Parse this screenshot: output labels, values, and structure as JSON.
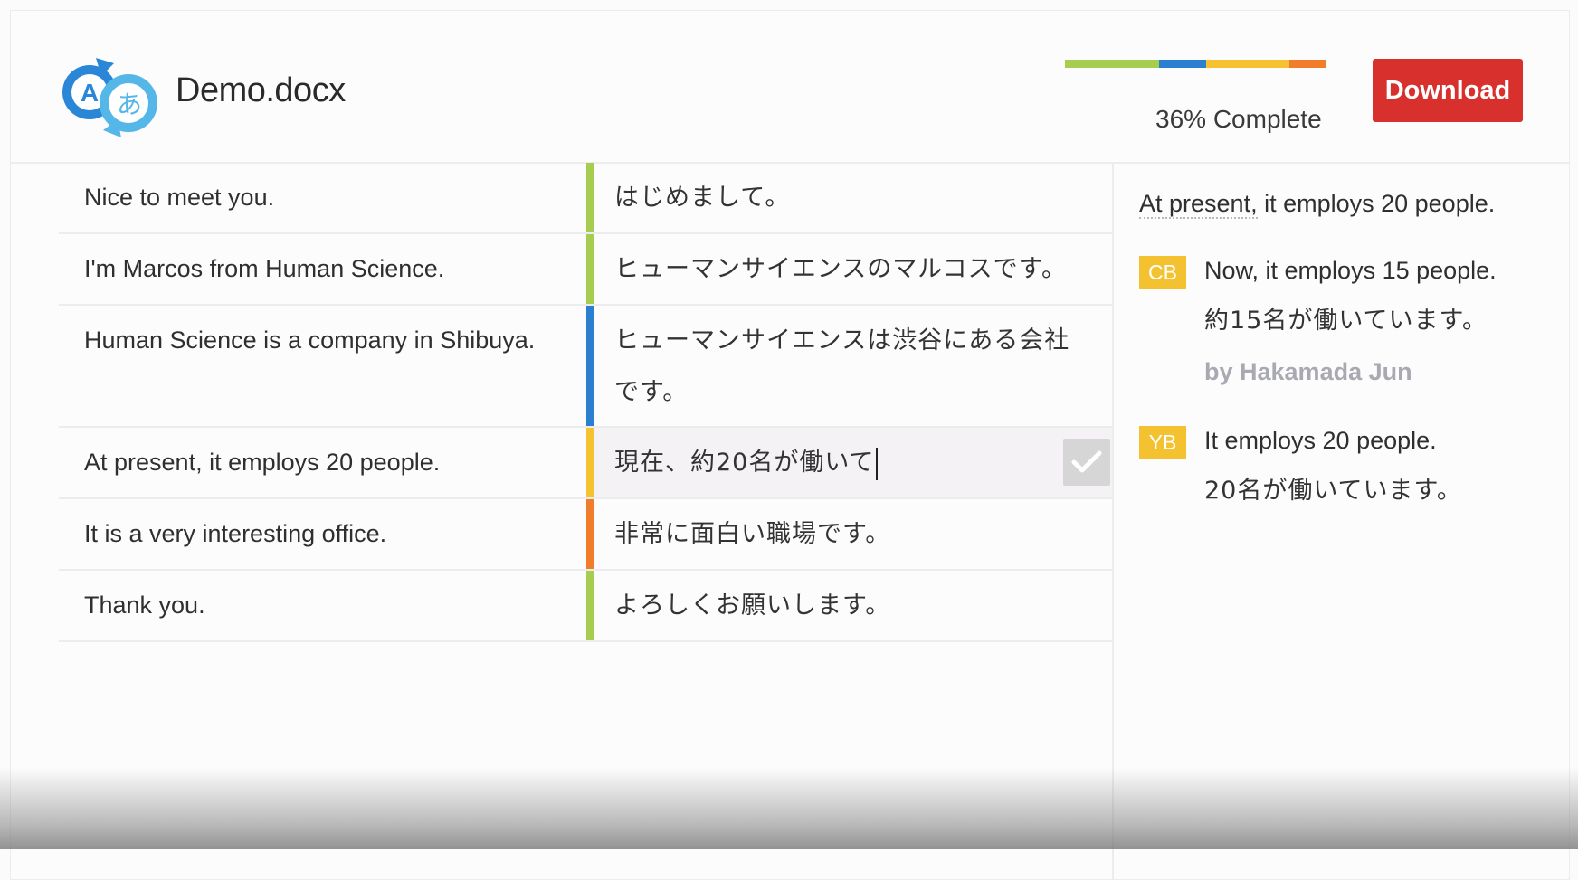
{
  "document": {
    "title": "Demo.docx"
  },
  "progress": {
    "percent": 36,
    "label": "36% Complete",
    "segments": [
      {
        "color": "#a6cd4f",
        "fraction": 0.36
      },
      {
        "color": "#2b7fd0",
        "fraction": 0.18
      },
      {
        "color": "#f6c231",
        "fraction": 0.32
      },
      {
        "color": "#f17d2b",
        "fraction": 0.14
      }
    ]
  },
  "toolbar": {
    "download_label": "Download"
  },
  "segments": [
    {
      "source": "Nice to meet you.",
      "target": "はじめまして。",
      "status_color": "#a6cd4f"
    },
    {
      "source": "I'm Marcos from Human Science.",
      "target": "ヒューマンサイエンスのマルコスです。",
      "status_color": "#a6cd4f"
    },
    {
      "source": "Human Science is a company in Shibuya.",
      "target": "ヒューマンサイエンスは渋谷にある会社です。",
      "status_color": "#2b7fd0"
    },
    {
      "source": "At present, it employs 20 people.",
      "target": "現在、約20名が働いて",
      "status_color": "#f6c231",
      "active": true
    },
    {
      "source": "It is a very interesting office.",
      "target": "非常に面白い職場です。",
      "status_color": "#f17d2b"
    },
    {
      "source": "Thank you.",
      "target": "よろしくお願いします。",
      "status_color": "#a6cd4f"
    }
  ],
  "panel": {
    "source_prefix": "At present,",
    "source_rest": " it employs 20 people.",
    "suggestions": [
      {
        "badge": "CB",
        "en": "Now, it employs 15 people.",
        "ja": "約15名が働いています。",
        "by": "by Hakamada Jun"
      },
      {
        "badge": "YB",
        "en": "It employs 20 people.",
        "ja": "20名が働いています。"
      }
    ]
  },
  "icons": {
    "logo": "translate-logo-icon",
    "confirm": "checkmark-icon"
  }
}
